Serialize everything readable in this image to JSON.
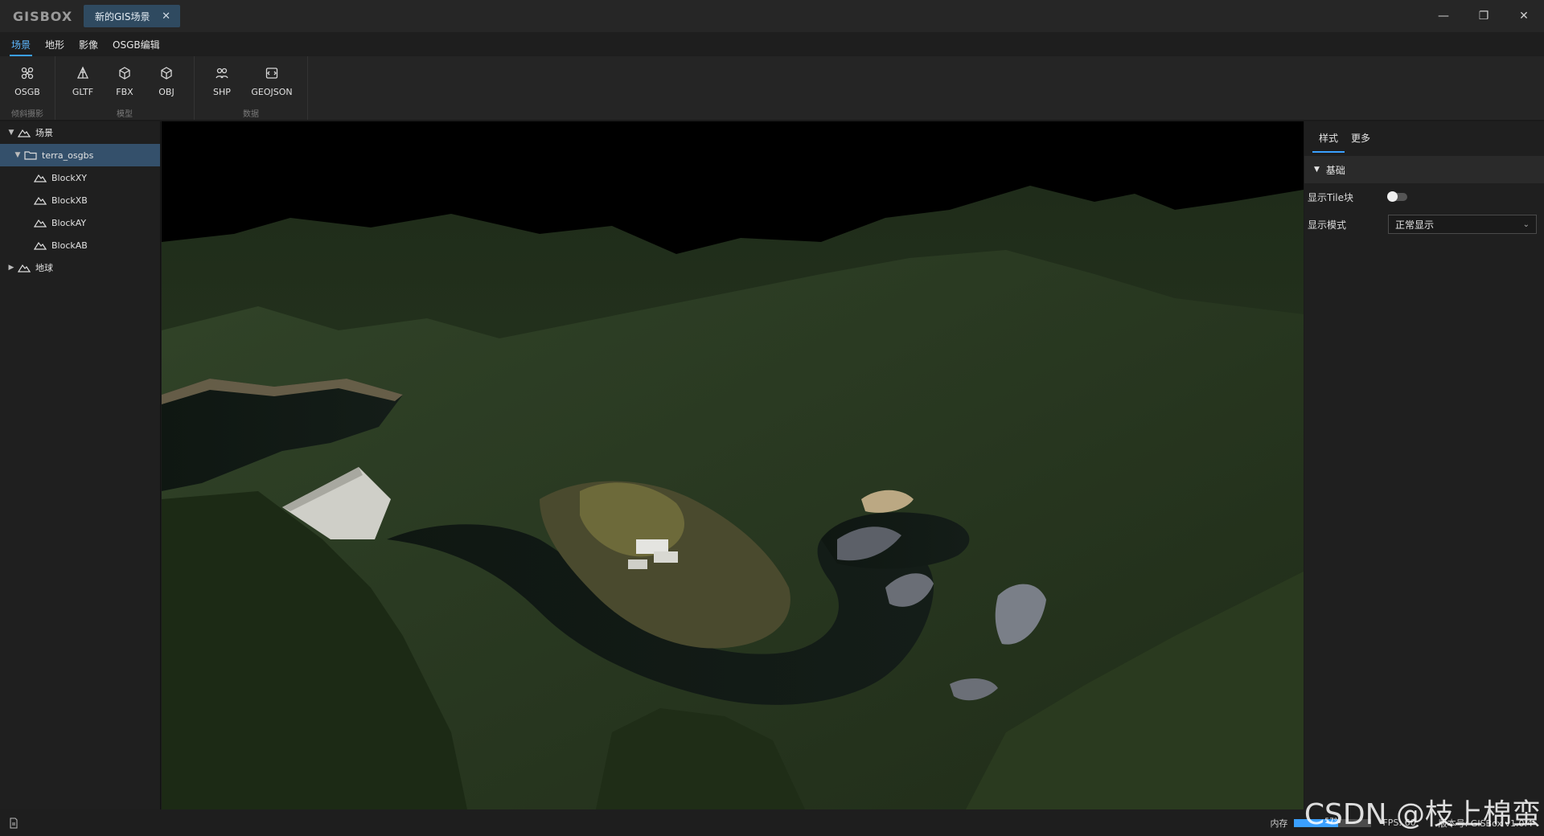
{
  "app": {
    "logo": "GISBOX",
    "doc_tab": "新的GIS场景",
    "doc_tab_close": "✕",
    "window": {
      "minimize": "—",
      "restore": "❐",
      "close": "✕"
    }
  },
  "menu": [
    {
      "label": "场景",
      "active": true
    },
    {
      "label": "地形",
      "active": false
    },
    {
      "label": "影像",
      "active": false
    },
    {
      "label": "OSGB编辑",
      "active": false
    }
  ],
  "toolbar": {
    "groups": [
      {
        "label": "倾斜摄影",
        "buttons": [
          {
            "label": "OSGB",
            "icon": "osgb-icon"
          }
        ]
      },
      {
        "label": "模型",
        "buttons": [
          {
            "label": "GLTF",
            "icon": "gltf-icon"
          },
          {
            "label": "FBX",
            "icon": "fbx-icon"
          },
          {
            "label": "OBJ",
            "icon": "obj-icon"
          }
        ]
      },
      {
        "label": "数据",
        "buttons": [
          {
            "label": "SHP",
            "icon": "shp-icon"
          },
          {
            "label": "GEOJSON",
            "icon": "geojson-icon"
          }
        ]
      }
    ]
  },
  "tree": [
    {
      "label": "场景",
      "level": 0,
      "caret": "▼",
      "icon": "scene-icon"
    },
    {
      "label": "terra_osgbs",
      "level": 1,
      "caret": "▼",
      "icon": "folder-icon",
      "selected": true
    },
    {
      "label": "BlockXY",
      "level": 2,
      "icon": "block-icon"
    },
    {
      "label": "BlockXB",
      "level": 2,
      "icon": "block-icon"
    },
    {
      "label": "BlockAY",
      "level": 2,
      "icon": "block-icon"
    },
    {
      "label": "BlockAB",
      "level": 2,
      "icon": "block-icon"
    },
    {
      "label": "地球",
      "level": 0,
      "caret": "▶",
      "icon": "globe-icon"
    }
  ],
  "panel": {
    "tabs": [
      {
        "label": "样式",
        "active": true
      },
      {
        "label": "更多",
        "active": false
      }
    ],
    "section": "基础",
    "show_tile_label": "显示Tile块",
    "show_tile_on": false,
    "display_mode_label": "显示模式",
    "display_mode_value": "正常显示"
  },
  "status": {
    "memory_label": "内存",
    "memory_percent": 57,
    "memory_text": "57%",
    "fps": "FPS: 60",
    "version": "版本号: GISBox v1.0.4"
  },
  "watermark": "CSDN @枝上棉蛮",
  "colors": {
    "accent": "#3aa0ff",
    "selected_row": "#34506b",
    "tab_bg": "#2f4a60"
  }
}
